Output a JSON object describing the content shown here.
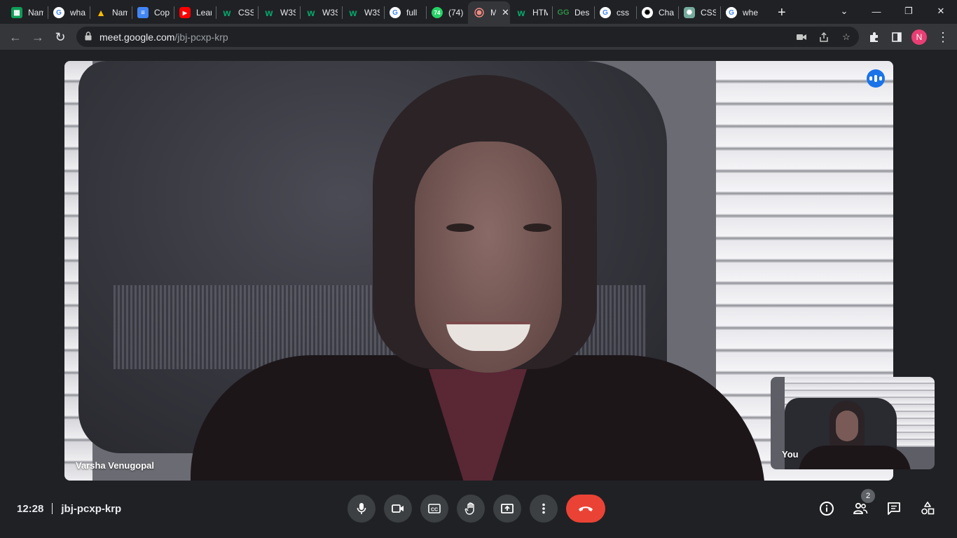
{
  "browser": {
    "tabs": [
      {
        "title": "Nam",
        "icon": "sheets",
        "glyph": "▦"
      },
      {
        "title": "wha",
        "icon": "google",
        "glyph": "G"
      },
      {
        "title": "Nam",
        "icon": "drive",
        "glyph": "▲"
      },
      {
        "title": "Cop",
        "icon": "docs",
        "glyph": "≡"
      },
      {
        "title": "Lear",
        "icon": "yt",
        "glyph": "▶"
      },
      {
        "title": "CSS",
        "icon": "w3",
        "glyph": "w"
      },
      {
        "title": "W3S",
        "icon": "w3",
        "glyph": "w"
      },
      {
        "title": "W3S",
        "icon": "w3",
        "glyph": "w"
      },
      {
        "title": "W3S",
        "icon": "w3",
        "glyph": "w"
      },
      {
        "title": "full",
        "icon": "google",
        "glyph": "G"
      },
      {
        "title": "(74)",
        "icon": "wa",
        "glyph": "74"
      },
      {
        "title": "M",
        "icon": "rec",
        "glyph": ""
      },
      {
        "title": "HTM",
        "icon": "w3",
        "glyph": "w"
      },
      {
        "title": "Des",
        "icon": "gfg",
        "glyph": "GG"
      },
      {
        "title": "css",
        "icon": "google",
        "glyph": "G"
      },
      {
        "title": "Cha",
        "icon": "gpt",
        "glyph": "✺"
      },
      {
        "title": "CSS",
        "icon": "gpt2",
        "glyph": "✺"
      },
      {
        "title": "whe",
        "icon": "google",
        "glyph": "G"
      }
    ],
    "new_tab_label": "+",
    "url_host": "meet.google.com",
    "url_path": "/jbj-pcxp-krp",
    "profile_initial": "N",
    "profile_color": "#e83e74"
  },
  "meet": {
    "main_participant_name": "Varsha Venugopal",
    "self_label": "You",
    "time": "12:28",
    "meeting_code": "jbj-pcxp-krp",
    "participant_count": "2",
    "accent_blue": "#1a73e8",
    "hangup_red": "#ea4335"
  }
}
